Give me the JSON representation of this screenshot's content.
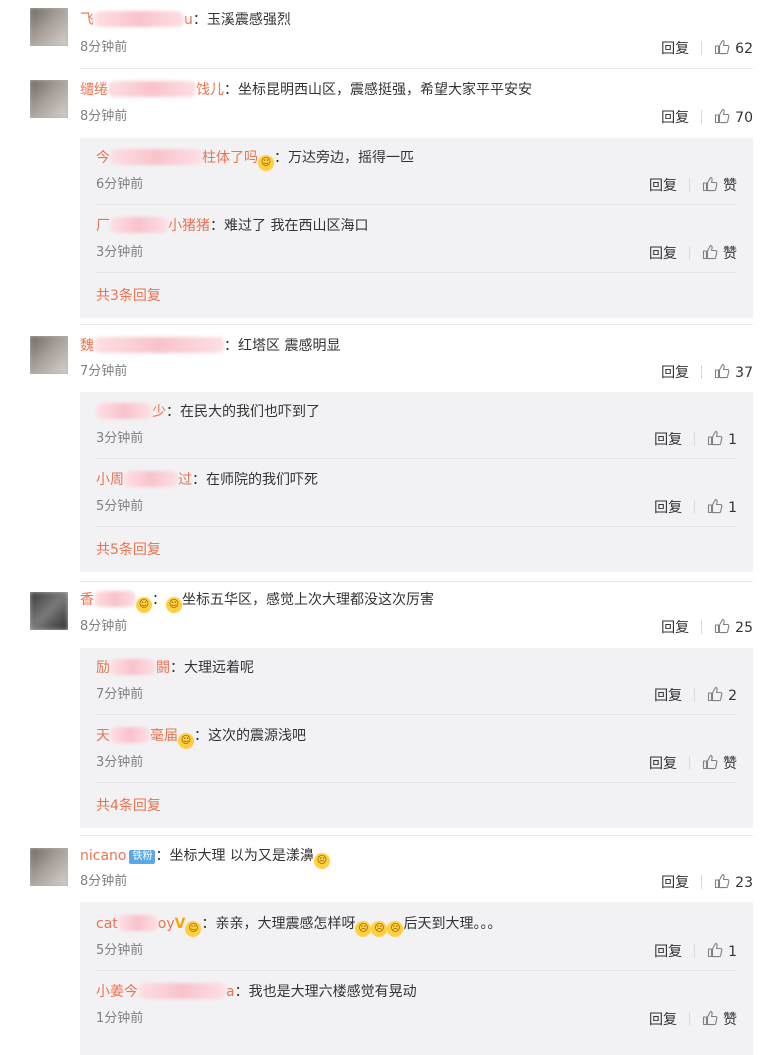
{
  "comments": [
    {
      "name_start": "飞",
      "name_end": "u",
      "text": "：玉溪震感强烈",
      "time": "8分钟前",
      "reply": "回复",
      "likes": "62",
      "replies": []
    },
    {
      "name_start": "缱绻",
      "name_end": "饯儿",
      "text": "：坐标昆明西山区，震感挺强，希望大家平平安安",
      "time": "8分钟前",
      "reply": "回复",
      "likes": "70",
      "replies": [
        {
          "name_start": "今",
          "name_end": "柱体了吗",
          "emoji": true,
          "text": "：万达旁边，摇得一匹",
          "time": "6分钟前",
          "reply": "回复",
          "likes": "赞"
        },
        {
          "name_start": "厂",
          "name_end": "小猪猪",
          "text": "：难过了  我在西山区海口",
          "time": "3分钟前",
          "reply": "回复",
          "likes": "赞"
        }
      ],
      "more": "共3条回复"
    },
    {
      "name_start": "魏",
      "name_end": "",
      "text": "：红塔区  震感明显",
      "time": "7分钟前",
      "reply": "回复",
      "likes": "37",
      "replies": [
        {
          "name_start": "",
          "name_end": "少",
          "text": "：在民大的我们也吓到了",
          "time": "3分钟前",
          "reply": "回复",
          "likes": "1"
        },
        {
          "name_start": "小周",
          "name_end": "过",
          "text": "：在师院的我们吓死",
          "time": "5分钟前",
          "reply": "回复",
          "likes": "1"
        }
      ],
      "more": "共5条回复"
    },
    {
      "name_start": "香",
      "name_end": "",
      "text": "坐标五华区，感觉上次大理都没这次厉害",
      "time": "8分钟前",
      "reply": "回复",
      "likes": "25",
      "replies": [
        {
          "name_start": "励",
          "name_end": "闘",
          "text": "：大理远着呢",
          "time": "7分钟前",
          "reply": "回复",
          "likes": "2"
        },
        {
          "name_start": "天",
          "name_end": "毫届",
          "emoji": true,
          "text": "：这次的震源浅吧",
          "time": "3分钟前",
          "reply": "回复",
          "likes": "赞"
        }
      ],
      "more": "共4条回复"
    },
    {
      "name_start": "nicano",
      "name_end": "",
      "badge": "铁粉",
      "text": "：坐标大理 以为又是漾濞",
      "time": "8分钟前",
      "reply": "回复",
      "likes": "23",
      "replies": [
        {
          "name_start": "cat",
          "name_end": "oy",
          "vip": "V",
          "emoji": true,
          "text": "：亲亲，大理震感怎样呀",
          "text_after": "后天到大理。。。",
          "time": "5分钟前",
          "reply": "回复",
          "likes": "1"
        },
        {
          "name_start": "小姜今",
          "name_end": "a",
          "text": "：我也是大理六楼感觉有晃动",
          "time": "1分钟前",
          "reply": "回复",
          "likes": "赞"
        }
      ]
    }
  ]
}
